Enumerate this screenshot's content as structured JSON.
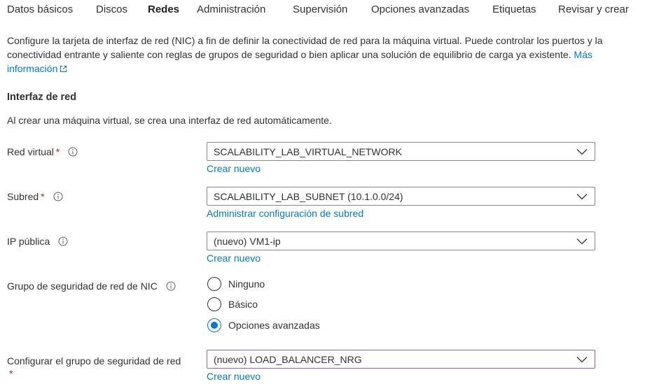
{
  "tabs": [
    {
      "label": "Datos básicos",
      "active": false
    },
    {
      "label": "Discos",
      "active": false
    },
    {
      "label": "Redes",
      "active": true
    },
    {
      "label": "Administración",
      "active": false
    },
    {
      "label": "Supervisión",
      "active": false
    },
    {
      "label": "Opciones avanzadas",
      "active": false
    },
    {
      "label": "Etiquetas",
      "active": false
    },
    {
      "label": "Revisar y crear",
      "active": false
    }
  ],
  "intro": {
    "text": "Configure la tarjeta de interfaz de red (NIC) a fin de definir la conectividad de red para la máquina virtual. Puede controlar los puertos y la conectividad entrante y saliente con reglas de grupos de seguridad o bien aplicar una solución de equilibrio de carga ya existente.",
    "link": "Más información"
  },
  "network_interface": {
    "title": "Interfaz de red",
    "description": "Al crear una máquina virtual, se crea una interfaz de red automáticamente."
  },
  "fields": {
    "virtual_network": {
      "label": "Red virtual",
      "required_mark": "*",
      "value": "SCALABILITY_LAB_VIRTUAL_NETWORK",
      "link": "Crear nuevo"
    },
    "subnet": {
      "label": "Subred",
      "required_mark": "*",
      "value": "SCALABILITY_LAB_SUBNET (10.1.0.0/24)",
      "link": "Administrar configuración de subred"
    },
    "public_ip": {
      "label": "IP pública",
      "value": "(nuevo) VM1-ip",
      "link": "Crear nuevo"
    },
    "nic_nsg": {
      "label": "Grupo de seguridad de red de NIC",
      "options": [
        "Ninguno",
        "Básico",
        "Opciones avanzadas"
      ],
      "selected": "Opciones avanzadas"
    },
    "configure_nsg": {
      "label": "Configurar el grupo de seguridad de red",
      "required_mark": "*",
      "value": "(nuevo) LOAD_BALANCER_NRG",
      "link": "Crear nuevo"
    }
  },
  "colors": {
    "accent": "#0078d4",
    "required": "#a4262c",
    "focus_border": "#8764b8"
  }
}
